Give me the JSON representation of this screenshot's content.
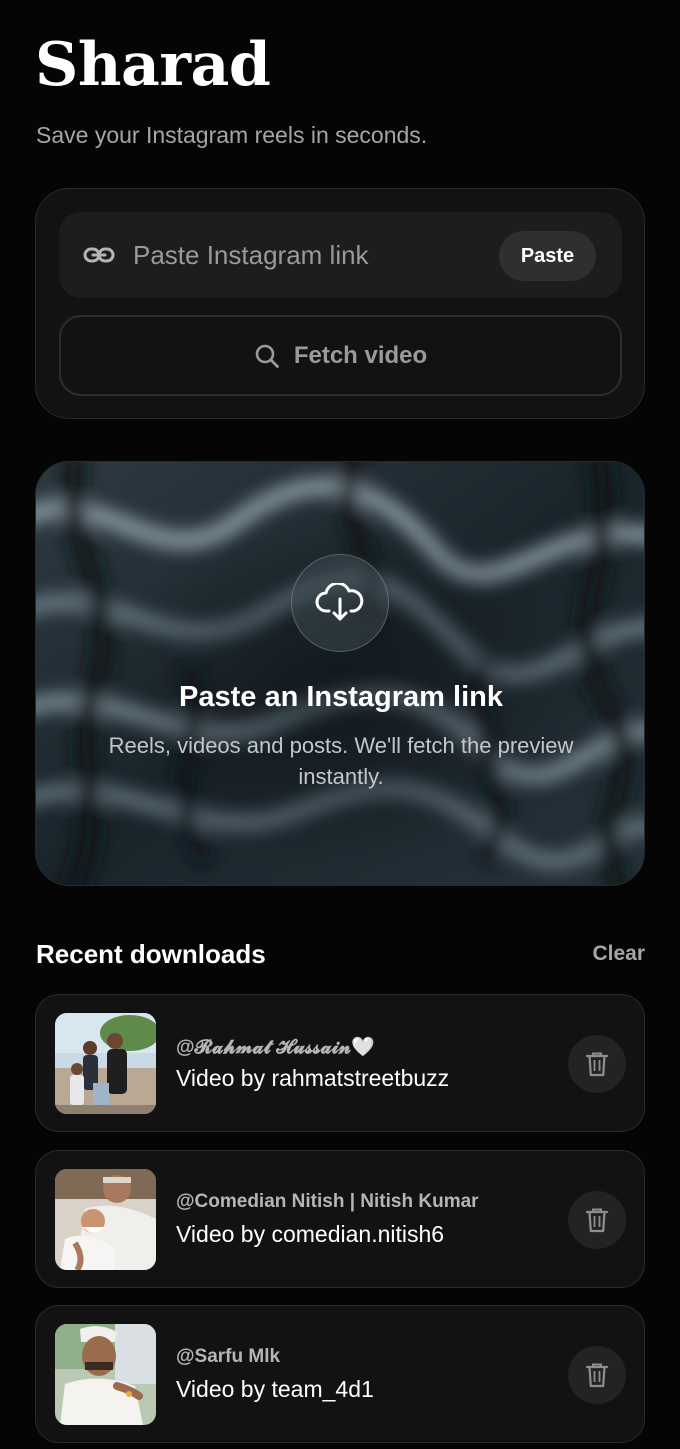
{
  "app": {
    "title": "Sharad",
    "tagline": "Save your Instagram reels in seconds."
  },
  "input_card": {
    "placeholder": "Paste Instagram link",
    "value": "",
    "paste_label": "Paste",
    "fetch_label": "Fetch video",
    "link_icon": "link-icon",
    "search_icon": "search-icon"
  },
  "hero": {
    "icon": "cloud-download-icon",
    "heading": "Paste an Instagram link",
    "subtext": "Reels, videos and posts. We'll fetch the preview instantly."
  },
  "recent": {
    "title": "Recent downloads",
    "clear_label": "Clear",
    "items": [
      {
        "author": "@𝓡𝓪𝓱𝓶𝓪𝓽 𝓗𝓾𝓼𝓼𝓪𝓲𝓷🤍",
        "description": "Video by rahmatstreetbuzz",
        "action_icon": "trash-icon"
      },
      {
        "author": "@Comedian Nitish | Nitish Kumar",
        "description": "Video by comedian.nitish6",
        "action_icon": "trash-icon"
      },
      {
        "author": "@Sarfu Mlk",
        "description": "Video by team_4d1",
        "action_icon": "trash-icon"
      }
    ]
  },
  "colors": {
    "background": "#050505",
    "card": "#121212",
    "input": "#1d1d1d",
    "muted_text": "#a6a6a6"
  }
}
